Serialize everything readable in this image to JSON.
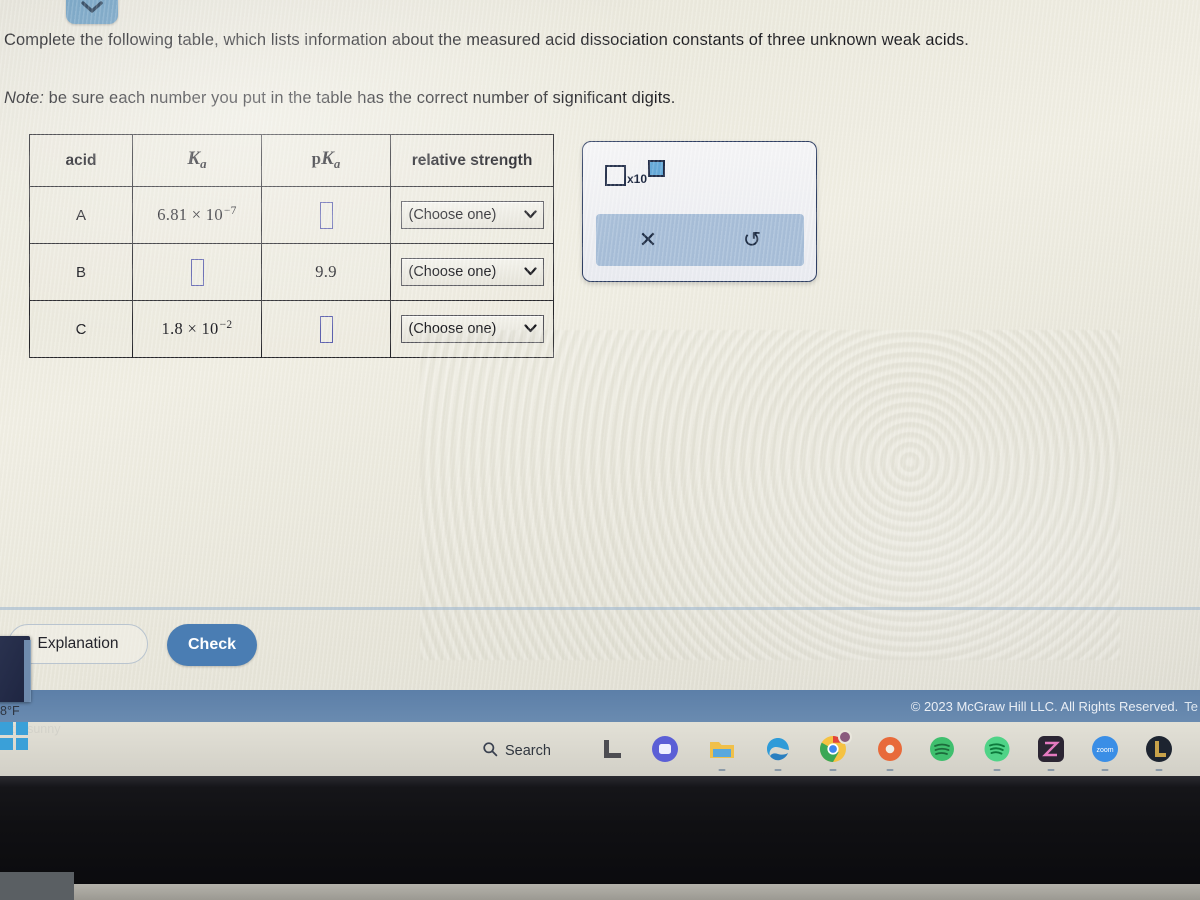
{
  "top_tab": {
    "icon": "chevron-down-icon",
    "glyph": "⌄"
  },
  "prompt": {
    "line1": "Complete the following table, which lists information about the measured acid dissociation constants of three unknown weak acids.",
    "line2_note": "Note:",
    "line2_rest": " be sure each number you put in the table has the correct number of significant digits."
  },
  "table": {
    "headers": {
      "acid": "acid",
      "ka_main": "K",
      "ka_sub": "a",
      "pka_prefix": "p",
      "pka_main": "K",
      "pka_sub": "a",
      "relative_strength": "relative strength"
    },
    "rows": [
      {
        "acid": "A",
        "ka_value": "6.81 × 10",
        "ka_exponent": "−7",
        "ka_is_input": false,
        "pka_value": "",
        "pka_is_input": true,
        "relative_strength": "(Choose one)",
        "caret": "⌄"
      },
      {
        "acid": "B",
        "ka_value": "",
        "ka_exponent": "",
        "ka_is_input": true,
        "pka_value": "9.9",
        "pka_is_input": false,
        "relative_strength": "(Choose one)",
        "caret": "⌄"
      },
      {
        "acid": "C",
        "ka_value": "1.8 × 10",
        "ka_exponent": "−2",
        "ka_is_input": false,
        "pka_value": "",
        "pka_is_input": true,
        "relative_strength": "(Choose one)",
        "caret": "⌄"
      }
    ]
  },
  "math_palette": {
    "scientific_notation_label": "x10",
    "clear_glyph": "✕",
    "undo_glyph": "↺"
  },
  "buttons": {
    "explanation": "Explanation",
    "check": "Check"
  },
  "footer": {
    "copyright": "© 2023 McGraw Hill LLC. All Rights Reserved.",
    "extra": "Te"
  },
  "weather": {
    "temperature": "8°F",
    "condition": "artly sunny"
  },
  "taskbar": {
    "search_label": "Search",
    "search_icon": "search-icon",
    "icons": [
      {
        "name": "file-explorer-icon"
      },
      {
        "name": "microsoft-edge-icon"
      },
      {
        "name": "google-chrome-icon"
      },
      {
        "name": "firefox-icon"
      },
      {
        "name": "green-app-icon"
      },
      {
        "name": "spotify-icon"
      },
      {
        "name": "pink-app-icon"
      },
      {
        "name": "zoom-icon",
        "label": "zoom"
      },
      {
        "name": "league-of-legends-icon"
      }
    ]
  },
  "colors": {
    "accent_blue": "#4a7db3",
    "footer_blue": "#5c7fa8",
    "input_border": "#5b5fae",
    "palette_bar": "#a8bfd9"
  }
}
